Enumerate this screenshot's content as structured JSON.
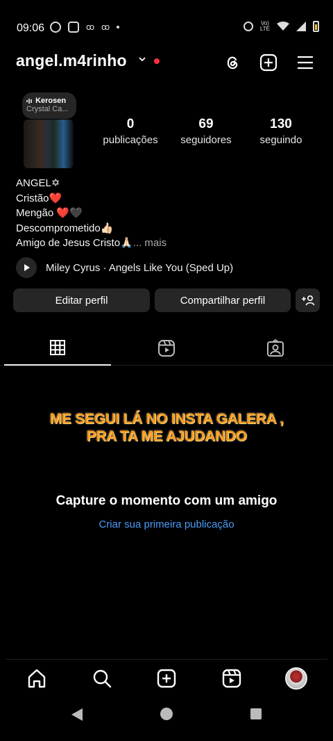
{
  "status_bar": {
    "time": "09:06",
    "network_label": "LTE",
    "icons": [
      "whatsapp-icon",
      "instagram-icon",
      "app-icon",
      "app-icon",
      "dot-icon",
      "dnd-icon",
      "volte-icon",
      "wifi-icon",
      "signal-icon",
      "battery-icon"
    ]
  },
  "header": {
    "username": "angel.m4rinho",
    "icons": [
      "threads-icon",
      "create-icon",
      "menu-icon"
    ],
    "notification_color": "#ff3040"
  },
  "note": {
    "title": "Kerosen",
    "subtitle": "Crystal Ca..."
  },
  "stats": [
    {
      "value": "0",
      "label": "publicações"
    },
    {
      "value": "69",
      "label": "seguidores"
    },
    {
      "value": "130",
      "label": "seguindo"
    }
  ],
  "bio": {
    "lines": [
      "ANGEL✡",
      "Cristão❤️",
      "Mengão ❤️🖤",
      "Descomprometido👍🏻",
      "Amigo de Jesus Cristo🙏🏻"
    ],
    "more": "... mais"
  },
  "music": {
    "text": "Miley Cyrus · Angels Like You (Sped Up)"
  },
  "buttons": {
    "edit": "Editar perfil",
    "share": "Compartilhar perfil"
  },
  "tabs": [
    "grid-icon",
    "reels-icon",
    "tagged-icon"
  ],
  "promo": {
    "line1": "ME SEGUI LÁ NO INSTA GALERA ,",
    "line2": "PRA TA ME AJUDANDO"
  },
  "empty_state": {
    "title": "Capture o momento com um amigo",
    "link": "Criar sua primeira publicação"
  },
  "colors": {
    "background": "#000000",
    "button": "#262626",
    "link": "#4a9df8",
    "promo": "#f59a1b"
  }
}
